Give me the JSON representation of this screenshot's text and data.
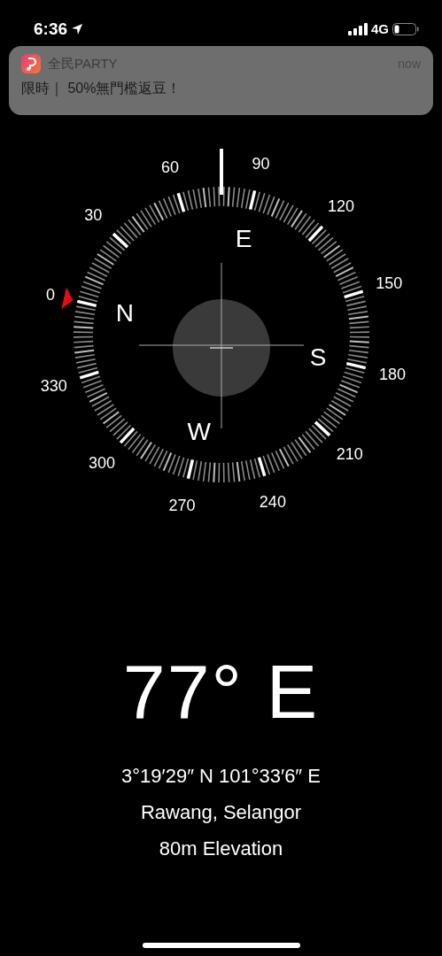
{
  "status_bar": {
    "time": "6:36",
    "network": "4G"
  },
  "notification": {
    "app": "全民PARTY",
    "time": "now",
    "message": "限時｜ 50%無門檻返豆！"
  },
  "compass": {
    "degree_labels": [
      "0",
      "30",
      "60",
      "90",
      "120",
      "150",
      "180",
      "210",
      "240",
      "270",
      "300",
      "330"
    ],
    "cardinals": [
      "N",
      "E",
      "S",
      "W"
    ]
  },
  "heading": "77° E",
  "coordinates": "3°19′29″ N  101°33′6″ E",
  "place": "Rawang, Selangor",
  "elevation": "80m Elevation"
}
